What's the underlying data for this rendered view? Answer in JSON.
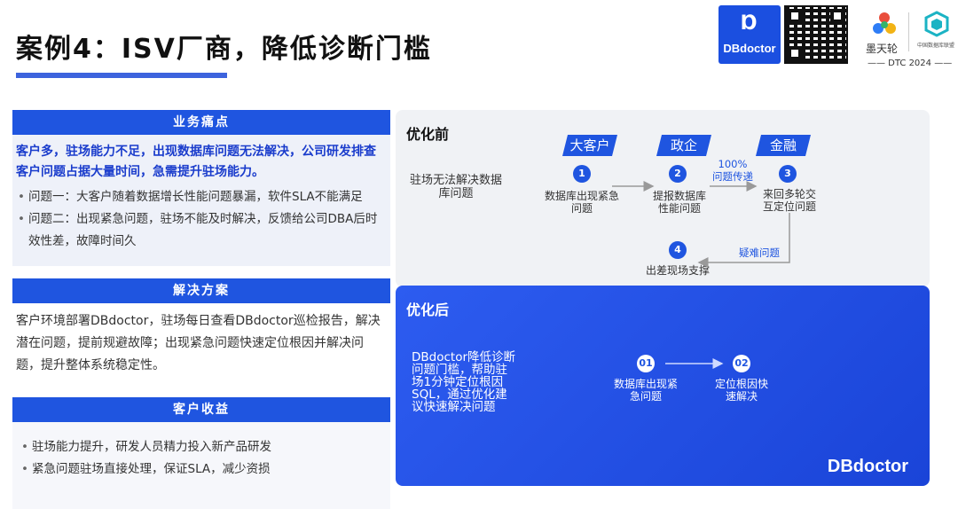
{
  "title": "案例4：ISV厂商，降低诊断门槛",
  "logos": {
    "dbdoctor": "DBdoctor",
    "modb": "墨天轮",
    "cdb": "中国数据库联盟",
    "dtc": "—— DTC 2024 ——"
  },
  "pain_points": {
    "heading": "业务痛点",
    "highlight": "客户多，驻场能力不足，出现数据库问题无法解决，公司研发排查客户问题占据大量时间，急需提升驻场能力。",
    "items": [
      "问题一：大客户随着数据增长性能问题暴漏，软件SLA不能满足",
      "问题二：出现紧急问题，驻场不能及时解决，反馈给公司DBA后时效性差，故障时间久"
    ]
  },
  "solution": {
    "heading": "解决方案",
    "text": "客户环境部署DBdoctor，驻场每日查看DBdoctor巡检报告，解决潜在问题，提前规避故障；出现紧急问题快速定位根因并解决问题，提升整体系统稳定性。"
  },
  "benefits": {
    "heading": "客户收益",
    "items": [
      "驻场能力提升，研发人员精力投入新产品研发",
      "紧急问题驻场直接处理，保证SLA，减少资损"
    ]
  },
  "before": {
    "label": "优化前",
    "desc": "驻场无法解决数据库问题",
    "categories": [
      "大客户",
      "政企",
      "金融"
    ],
    "steps": [
      {
        "num": "1",
        "text": "数据库出现紧急问题"
      },
      {
        "num": "2",
        "text": "提报数据库性能问题"
      },
      {
        "num": "3",
        "text": "来回多轮交互定位问题"
      },
      {
        "num": "4",
        "text": "出差现场支撑"
      }
    ],
    "note_pct": "100%",
    "note_pass": "问题传递",
    "note_hard": "疑难问题"
  },
  "after": {
    "label": "优化后",
    "desc": "DBdoctor降低诊断问题门槛，帮助驻场1分钟定位根因SQL，通过优化建议快速解决问题",
    "steps": [
      {
        "num": "01",
        "text": "数据库出现紧急问题"
      },
      {
        "num": "02",
        "text": "定位根因快速解决"
      }
    ],
    "brand": "DBdoctor"
  }
}
